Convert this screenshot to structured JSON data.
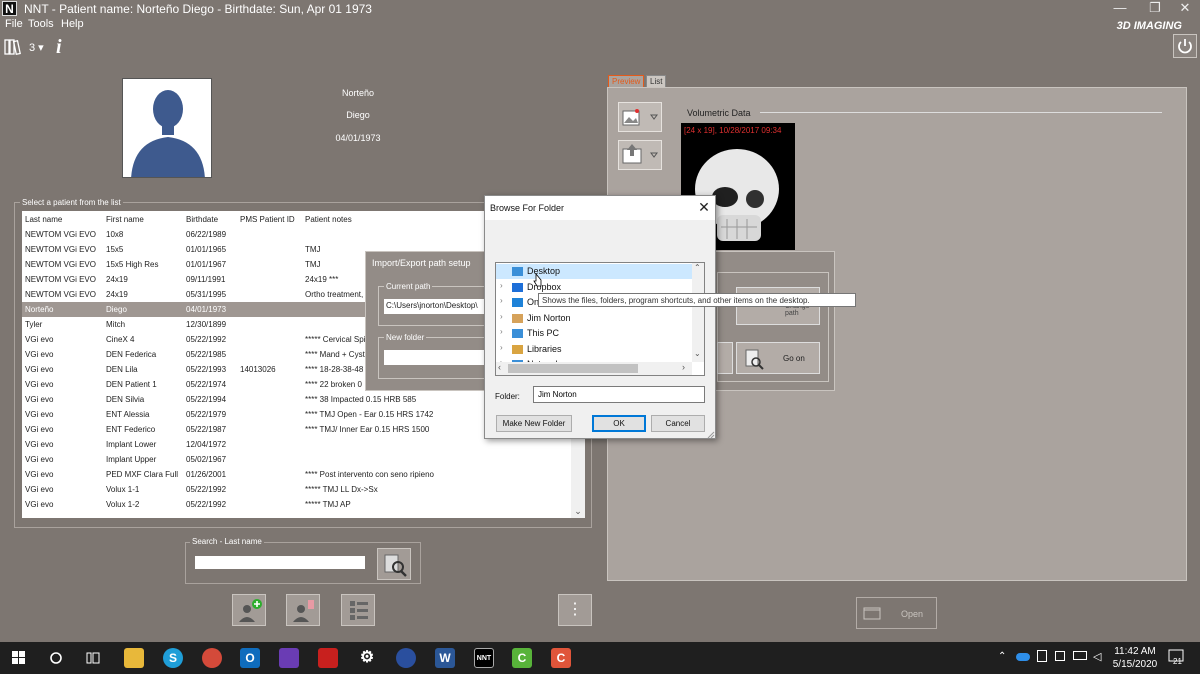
{
  "window": {
    "title": "NNT - Patient name: Norteño Diego - Birthdate: Sun, Apr 01 1973",
    "app_icon_letter": "N",
    "brand": "3D IMAGING",
    "controls": {
      "minimize": "—",
      "restore": "❐",
      "close": "✕"
    }
  },
  "menu": [
    "File",
    "Tools",
    "Help"
  ],
  "toolbar": {
    "archive_count": "3 ▾",
    "info_label": "i"
  },
  "patient": {
    "last_name": "Norteño",
    "first_name": "Diego",
    "birthdate": "04/01/1973"
  },
  "patient_list": {
    "legend": "Select a patient from the list",
    "columns": [
      "Last name",
      "First name",
      "Birthdate",
      "PMS Patient ID",
      "Patient notes"
    ],
    "rows": [
      {
        "last": "NEWTOM VGi EVO",
        "first": "10x8",
        "birth": "06/22/1989",
        "pms": "",
        "notes": ""
      },
      {
        "last": "NEWTOM VGi EVO",
        "first": "15x5",
        "birth": "01/01/1965",
        "pms": "",
        "notes": "TMJ"
      },
      {
        "last": "NEWTOM VGi EVO",
        "first": "15x5  High Res",
        "birth": "01/01/1967",
        "pms": "",
        "notes": "TMJ"
      },
      {
        "last": "NEWTOM VGi EVO",
        "first": "24x19",
        "birth": "09/11/1991",
        "pms": "",
        "notes": "24x19 ***"
      },
      {
        "last": "NEWTOM VGi EVO",
        "first": "24x19",
        "birth": "05/31/1995",
        "pms": "",
        "notes": "Ortho treatment,"
      },
      {
        "last": "Norteño",
        "first": "Diego",
        "birth": "04/01/1973",
        "pms": "",
        "notes": ""
      },
      {
        "last": "Tyler",
        "first": "Mitch",
        "birth": "12/30/1899",
        "pms": "",
        "notes": ""
      },
      {
        "last": "VGi evo",
        "first": "CineX 4",
        "birth": "05/22/1992",
        "pms": "",
        "notes": "***** Cervical Spi"
      },
      {
        "last": "VGi evo",
        "first": "DEN Federica",
        "birth": "05/22/1985",
        "pms": "",
        "notes": "**** Mand + Cyst"
      },
      {
        "last": "VGi evo",
        "first": "DEN Lila",
        "birth": "05/22/1993",
        "pms": "14013026",
        "notes": "**** 18-28-38-48"
      },
      {
        "last": "VGi evo",
        "first": "DEN Patient 1",
        "birth": "05/22/1974",
        "pms": "",
        "notes": "****  22 broken 0"
      },
      {
        "last": "VGi evo",
        "first": "DEN Silvia",
        "birth": "05/22/1994",
        "pms": "",
        "notes": "**** 38 Impacted 0.15 HRB 585"
      },
      {
        "last": "VGi evo",
        "first": "ENT Alessia",
        "birth": "05/22/1979",
        "pms": "",
        "notes": "**** TMJ Open  - Ear 0.15 HRS 1742"
      },
      {
        "last": "VGi evo",
        "first": "ENT Federico",
        "birth": "05/22/1987",
        "pms": "",
        "notes": "**** TMJ/ Inner Ear 0.15 HRS 1500"
      },
      {
        "last": "VGi evo",
        "first": "Implant Lower",
        "birth": "12/04/1972",
        "pms": "",
        "notes": ""
      },
      {
        "last": "VGi evo",
        "first": "Implant Upper",
        "birth": "05/02/1967",
        "pms": "",
        "notes": ""
      },
      {
        "last": "VGi evo",
        "first": "PED MXF Clara Full",
        "birth": "01/26/2001",
        "pms": "",
        "notes": "**** Post intervento con seno ripieno"
      },
      {
        "last": "VGi evo",
        "first": "Volux 1-1",
        "birth": "05/22/1992",
        "pms": "",
        "notes": "***** TMJ LL Dx->Sx"
      },
      {
        "last": "VGi evo",
        "first": "Volux 1-2",
        "birth": "05/22/1992",
        "pms": "",
        "notes": "***** TMJ AP"
      }
    ],
    "selected_index": 5
  },
  "search": {
    "legend": "Search - Last name",
    "value": ""
  },
  "more_label": "⋮",
  "right_panel": {
    "tabs": [
      "Preview",
      "List"
    ],
    "volumetric_label": "Volumetric Data",
    "volume_stamp": "[24 x 19], 10/28/2017 09:34",
    "open_label": "Open"
  },
  "import_export": {
    "title": "Import/Export path setup",
    "current_legend": "Current path",
    "current_path": "C:\\Users\\jnorton\\Desktop\\",
    "new_legend": "New folder",
    "change_label": "Change path",
    "goon_label": "Go on"
  },
  "browse_folder": {
    "title": "Browse For Folder",
    "close": "✕",
    "tree": [
      {
        "label": "Desktop",
        "chev": "",
        "icon": "desktop",
        "selected": true
      },
      {
        "label": "Dropbox",
        "chev": "›",
        "icon": "dropbox",
        "selected": false
      },
      {
        "label": "On",
        "chev": "›",
        "icon": "onedrive",
        "selected": false
      },
      {
        "label": "Jim Norton",
        "chev": "›",
        "icon": "user",
        "selected": false
      },
      {
        "label": "This PC",
        "chev": "›",
        "icon": "pc",
        "selected": false
      },
      {
        "label": "Libraries",
        "chev": "›",
        "icon": "libraries",
        "selected": false
      },
      {
        "label": "Network",
        "chev": "›",
        "icon": "network",
        "selected": false
      }
    ],
    "tooltip": "Shows the files, folders, program shortcuts, and other items on the desktop.",
    "folder_label": "Folder:",
    "folder_value": "Jim Norton",
    "make_new_label": "Make New Folder",
    "ok_label": "OK",
    "cancel_label": "Cancel"
  },
  "taskbar": {
    "time": "11:42 AM",
    "date": "5/15/2020",
    "notifications": "21",
    "nnt_label": "NNT"
  }
}
